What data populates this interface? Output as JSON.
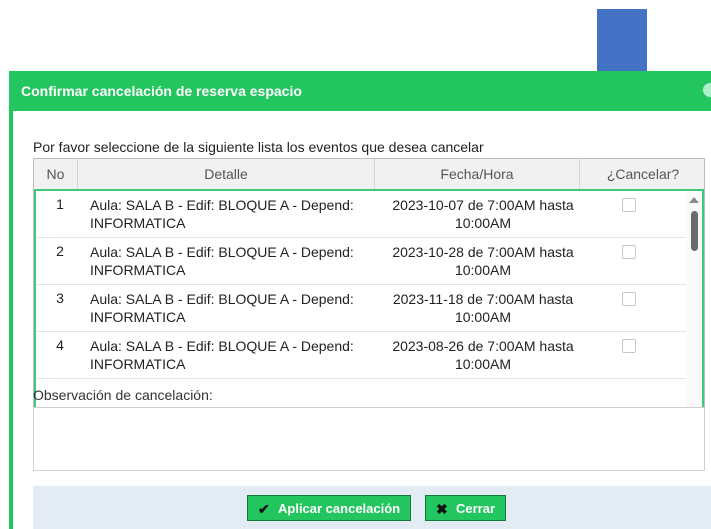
{
  "dialog": {
    "title": "Confirmar cancelación de reserva espacio",
    "instructions": "Por favor seleccione de la siguiente lista los eventos que desea cancelar"
  },
  "table": {
    "headers": {
      "no": "No",
      "detalle": "Detalle",
      "fecha": "Fecha/Hora",
      "cancelar": "¿Cancelar?"
    },
    "rows": [
      {
        "no": "1",
        "detalle_line1": "Aula: SALA B - Edif: BLOQUE A - Depend:",
        "detalle_line2": "INFORMATICA",
        "fecha_line1": "2023-10-07 de 7:00AM hasta",
        "fecha_line2": "10:00AM",
        "checked": false
      },
      {
        "no": "2",
        "detalle_line1": "Aula: SALA B - Edif: BLOQUE A - Depend:",
        "detalle_line2": "INFORMATICA",
        "fecha_line1": "2023-10-28 de 7:00AM hasta",
        "fecha_line2": "10:00AM",
        "checked": false
      },
      {
        "no": "3",
        "detalle_line1": "Aula: SALA B - Edif: BLOQUE A - Depend:",
        "detalle_line2": "INFORMATICA",
        "fecha_line1": "2023-11-18 de 7:00AM hasta",
        "fecha_line2": "10:00AM",
        "checked": false
      },
      {
        "no": "4",
        "detalle_line1": "Aula: SALA B - Edif: BLOQUE A - Depend:",
        "detalle_line2": "INFORMATICA",
        "fecha_line1": "2023-08-26 de 7:00AM hasta",
        "fecha_line2": "10:00AM",
        "checked": false
      }
    ]
  },
  "observacion": {
    "label": "Observación de cancelación:",
    "value": ""
  },
  "footer": {
    "apply_label": "Aplicar cancelación",
    "close_label": "Cerrar",
    "apply_icon": "check-icon",
    "close_icon": "x-icon"
  },
  "annotation": {
    "arrow_color": "#4472c4",
    "arrow_icon": "down-arrow-icon"
  },
  "colors": {
    "accent": "#22c55e",
    "footer_bg": "#e3ecf4"
  }
}
